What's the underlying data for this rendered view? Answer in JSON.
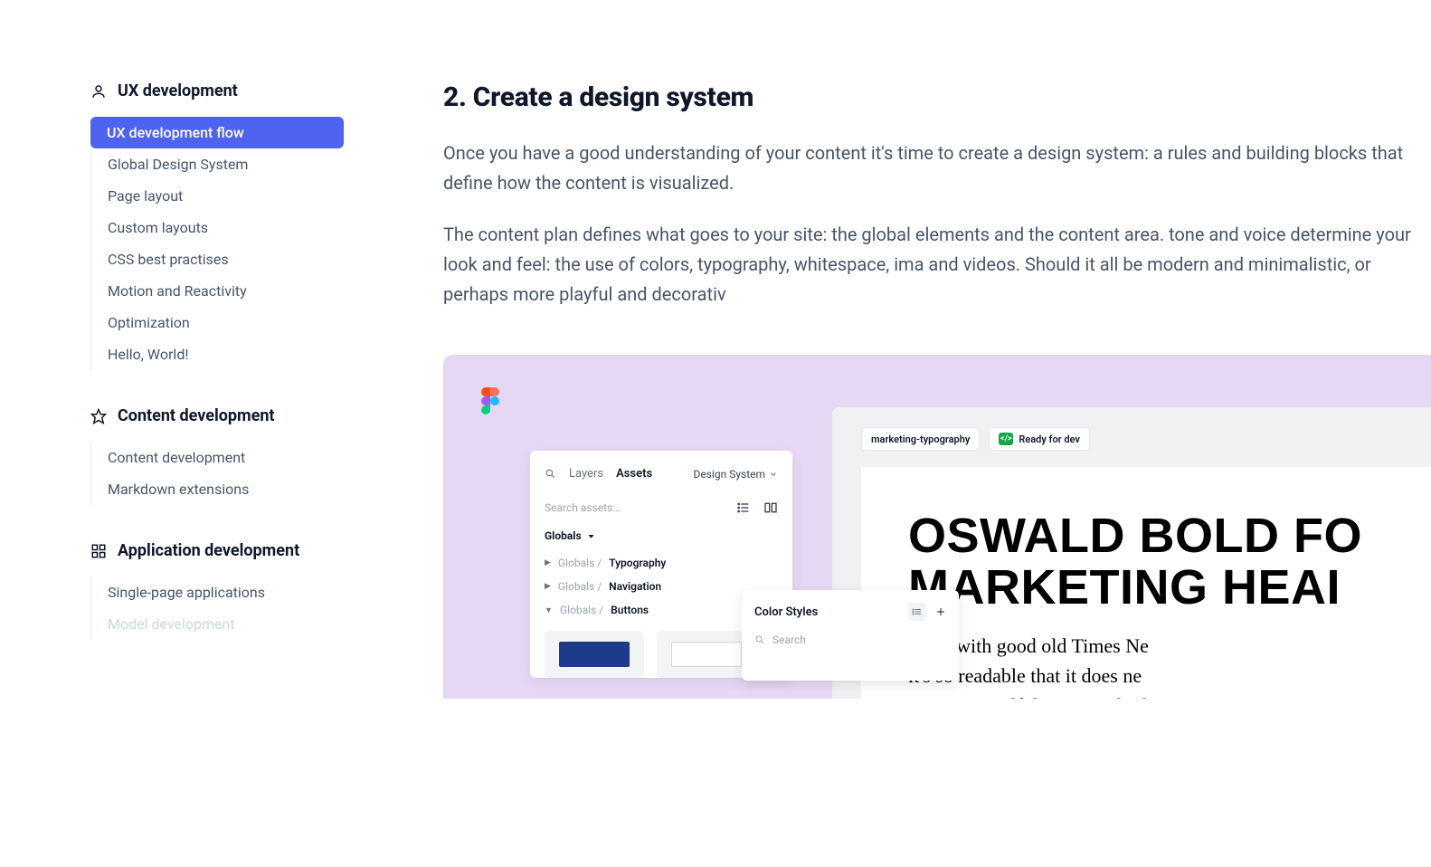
{
  "sidebar": {
    "sections": [
      {
        "icon": "user",
        "title": "UX development",
        "items": [
          {
            "label": "UX development flow",
            "active": true
          },
          {
            "label": "Global Design System"
          },
          {
            "label": "Page layout"
          },
          {
            "label": "Custom layouts"
          },
          {
            "label": "CSS best practises"
          },
          {
            "label": "Motion and Reactivity"
          },
          {
            "label": "Optimization"
          },
          {
            "label": "Hello, World!"
          }
        ]
      },
      {
        "icon": "star",
        "title": "Content development",
        "items": [
          {
            "label": "Content development"
          },
          {
            "label": "Markdown extensions"
          }
        ]
      },
      {
        "icon": "grid",
        "title": "Application development",
        "items": [
          {
            "label": "Single-page applications"
          },
          {
            "label": "Model development",
            "faded": true
          }
        ]
      }
    ]
  },
  "article": {
    "heading": "2. Create a design system",
    "para1": "Once you have a good understanding of your content it's time to create a design system: a rules and building blocks that define how the content is visualized.",
    "para2": "The content plan defines what goes to your site: the global elements and the content area. tone and voice determine your look and feel: the use of colors, typography, whitespace, ima and videos. Should it all be modern and minimalistic, or perhaps more playful and decorativ"
  },
  "mock": {
    "tabs": {
      "layers": "Layers",
      "assets": "Assets",
      "design_system": "Design System"
    },
    "search_placeholder": "Search assets…",
    "globals_label": "Globals",
    "tree_prefix": "Globals /",
    "tree": [
      "Typography",
      "Navigation",
      "Buttons"
    ],
    "color_panel": {
      "title": "Color Styles",
      "search": "Search",
      "group": ""
    },
    "chip1": "marketing-typography",
    "chip2": "Ready for dev",
    "headline1": "OSWALD BOLD FO",
    "headline2": "MARKETING HEAI",
    "body1": "dings with good old Times Ne",
    "body2": "it's so readable that it does ne",
    "body3": "ention to itself, leaving only th"
  }
}
